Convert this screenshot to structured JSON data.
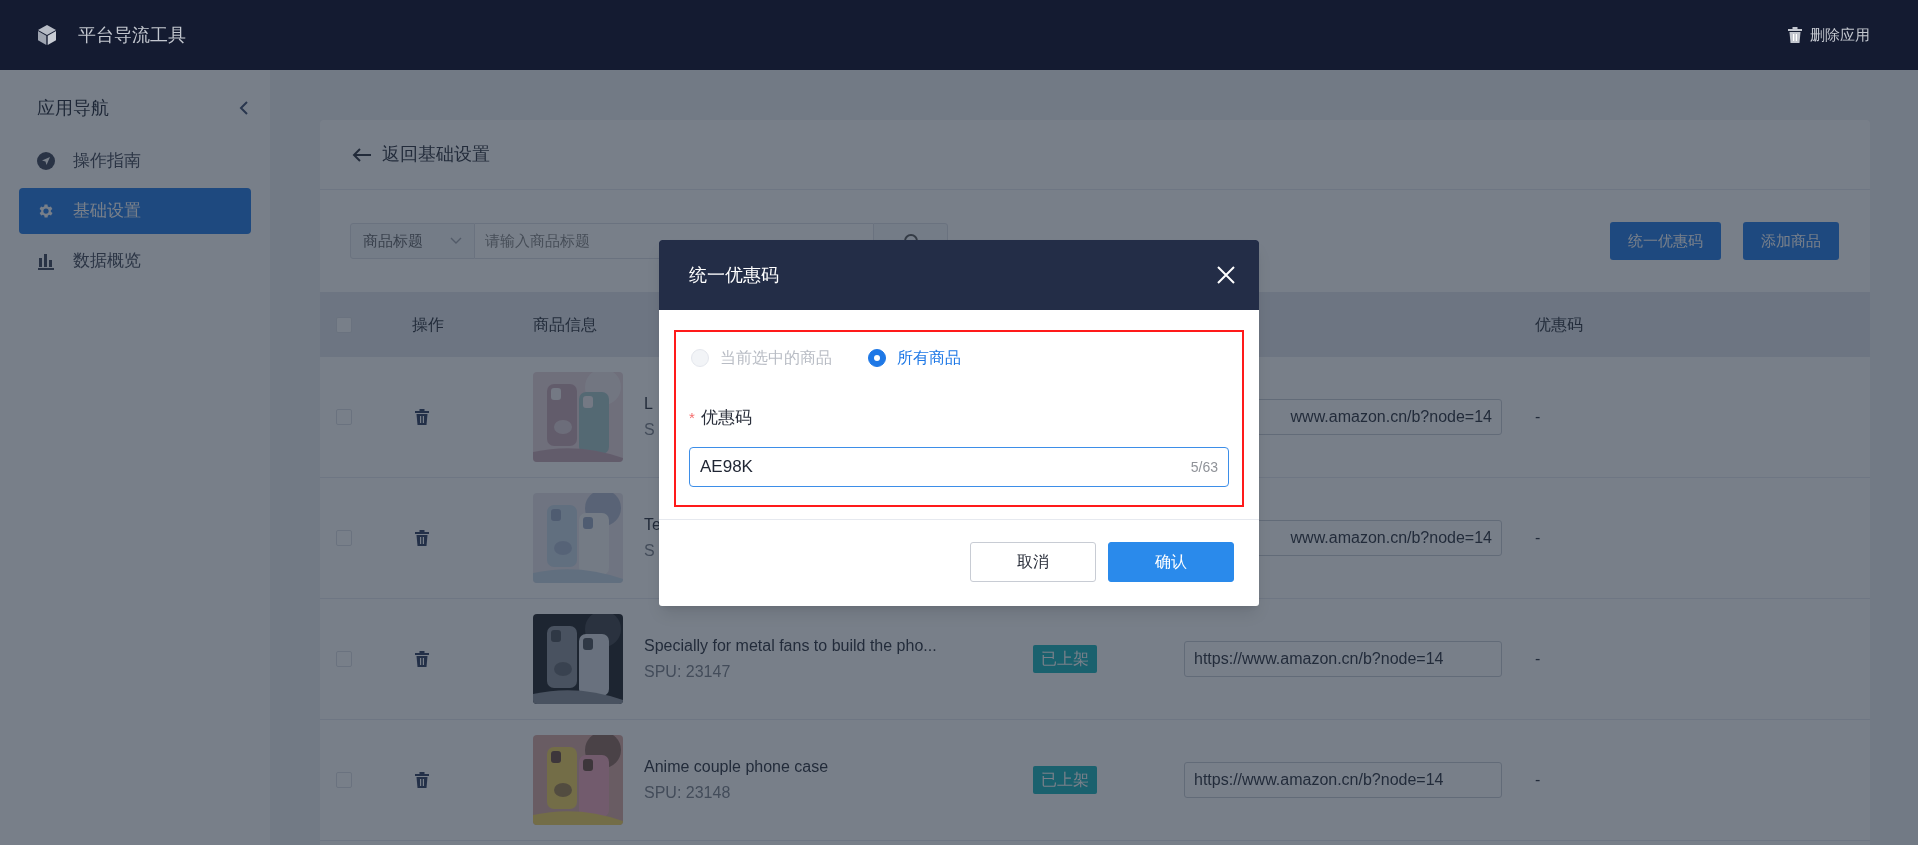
{
  "app_bar": {
    "title": "平台导流工具",
    "delete_action": "删除应用"
  },
  "sidebar": {
    "heading": "应用导航",
    "items": [
      {
        "label": "操作指南",
        "kind": "guide",
        "selected": false
      },
      {
        "label": "基础设置",
        "kind": "settings",
        "selected": true
      },
      {
        "label": "数据概览",
        "kind": "stats",
        "selected": false
      }
    ]
  },
  "page": {
    "back_link": "返回基础设置",
    "filter": {
      "field_select": "商品标题",
      "placeholder": "请输入商品标题"
    },
    "actions": [
      "统一优惠码",
      "添加商品"
    ],
    "table": {
      "header": {
        "select_all": {
          "checked": false
        },
        "operation": "操作",
        "product": "商品信息",
        "coupon": "优惠码"
      },
      "rows": [
        {
          "checked": false,
          "title": "L",
          "spu": "S",
          "link": "www.amazon.cn/b?node=14",
          "coupon": "-"
        },
        {
          "checked": false,
          "title": "Te",
          "spu": "S",
          "link": "www.amazon.cn/b?node=14",
          "coupon": "-"
        },
        {
          "checked": false,
          "title": "Specially for metal fans to build the pho...",
          "spu": "SPU: 23147",
          "status": "已上架",
          "link": "https://www.amazon.cn/b?node=14",
          "coupon": "-"
        },
        {
          "checked": false,
          "title": "Anime couple phone case",
          "spu": "SPU: 23148",
          "status": "已上架",
          "link": "https://www.amazon.cn/b?node=14",
          "coupon": "-"
        }
      ]
    }
  },
  "dialog": {
    "title": "统一优惠码",
    "highlighted": true,
    "scope_options": [
      {
        "label": "当前选中的商品",
        "selected": false,
        "disabled": true
      },
      {
        "label": "所有商品",
        "selected": true,
        "disabled": false
      }
    ],
    "field": {
      "required_mark": "*",
      "label": "优惠码",
      "value": "AE98K",
      "counter": "5/63"
    },
    "buttons": [
      {
        "label": "取消",
        "kind": "secondary"
      },
      {
        "label": "确认",
        "kind": "primary"
      }
    ]
  }
}
